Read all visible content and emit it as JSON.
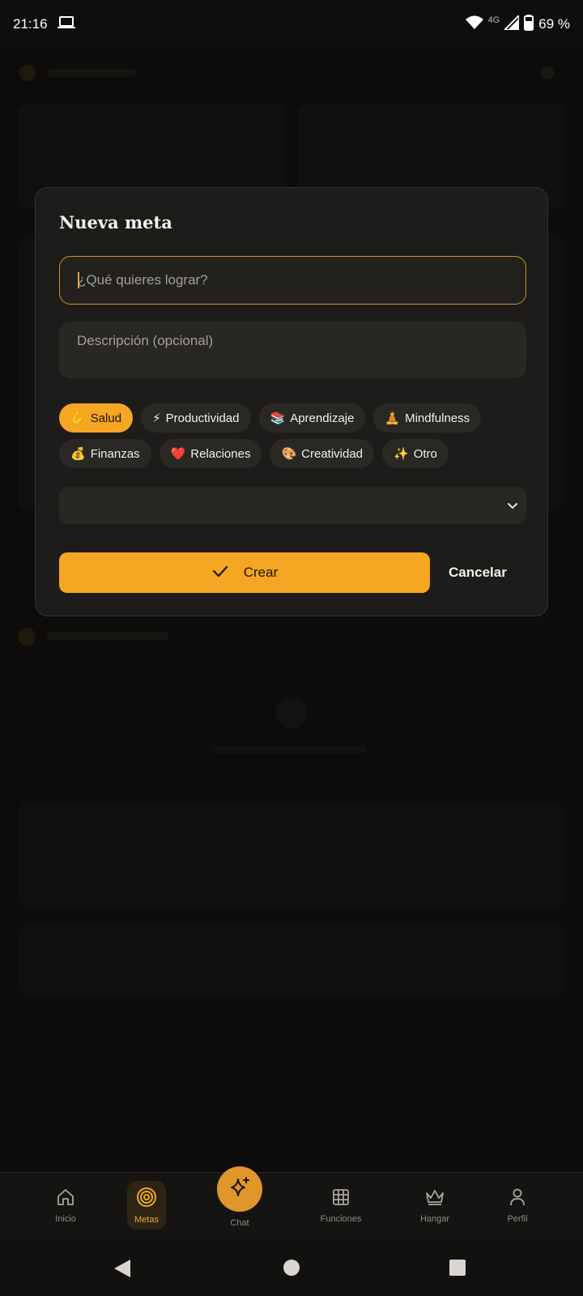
{
  "status_bar": {
    "time": "21:16",
    "network": "4G",
    "battery": "69 %"
  },
  "dialog": {
    "title": "Nueva meta",
    "title_placeholder": "¿Qué quieres lograr?",
    "description_placeholder": "Descripción (opcional)",
    "categories_row1": [
      {
        "emoji": "💪",
        "label": "Salud",
        "selected": true
      },
      {
        "emoji": "⚡",
        "label": "Productividad",
        "selected": false
      },
      {
        "emoji": "📚",
        "label": "Aprendizaje",
        "selected": false
      },
      {
        "emoji": "🧘",
        "label": "Mindfulness",
        "selected": false
      }
    ],
    "categories_row2": [
      {
        "emoji": "💰",
        "label": "Finanzas",
        "selected": false
      },
      {
        "emoji": "❤️",
        "label": "Relaciones",
        "selected": false
      },
      {
        "emoji": "🎨",
        "label": "Creatividad",
        "selected": false
      },
      {
        "emoji": "✨",
        "label": "Otro",
        "selected": false
      }
    ],
    "select_value": "",
    "create_label": "Crear",
    "cancel_label": "Cancelar"
  },
  "bottom_nav": {
    "items": [
      {
        "label": "Inicio",
        "icon": "home-icon"
      },
      {
        "label": "Metas",
        "icon": "target-icon",
        "active": true
      },
      {
        "label": "Chat",
        "icon": "sparkle-icon"
      },
      {
        "label": "Funciones",
        "icon": "grid-icon"
      },
      {
        "label": "Hangar",
        "icon": "crown-icon"
      },
      {
        "label": "Perfil",
        "icon": "person-icon"
      }
    ]
  },
  "colors": {
    "accent": "#f5a623",
    "background": "#121110",
    "dialog": "#1d1c1a"
  }
}
